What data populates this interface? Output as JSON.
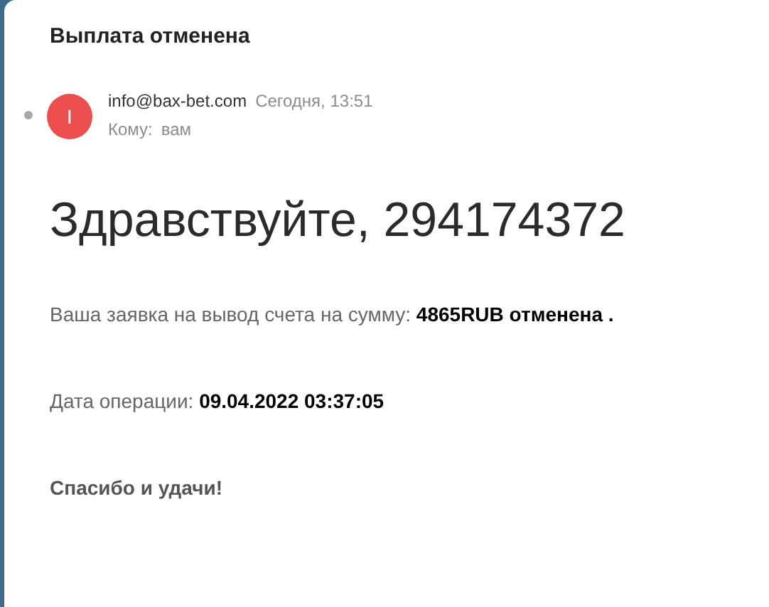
{
  "subject": "Выплата отменена",
  "message": {
    "unread": true,
    "avatar_letter": "I",
    "sender": "info@bax-bet.com",
    "time": "Сегодня, 13:51",
    "to_label": "Кому:",
    "to": "вам"
  },
  "body": [
    {
      "kind": "heading",
      "text": "Здравствуйте, 294174372"
    },
    {
      "kind": "line",
      "text": "Ваша заявка на вывод счета на сумму: **4865RUB отменена .**"
    },
    {
      "kind": "line",
      "text": "Дата операции: **09.04.2022 03:37:05**"
    },
    {
      "kind": "strong",
      "text": "Спасибо и удачи!"
    }
  ]
}
